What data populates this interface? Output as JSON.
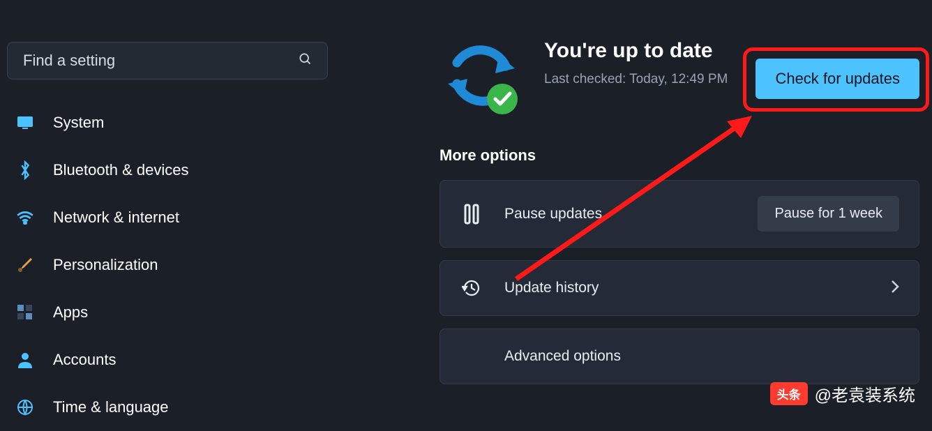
{
  "search": {
    "placeholder": "Find a setting"
  },
  "sidebar": {
    "items": [
      {
        "label": "System",
        "icon": "system-icon",
        "color": "#4cc2ff"
      },
      {
        "label": "Bluetooth & devices",
        "icon": "bluetooth-icon",
        "color": "#4cc2ff"
      },
      {
        "label": "Network & internet",
        "icon": "wifi-icon",
        "color": "#4cc2ff"
      },
      {
        "label": "Personalization",
        "icon": "brush-icon",
        "color": "#e8a04a"
      },
      {
        "label": "Apps",
        "icon": "apps-icon",
        "color": "#6f7a8c"
      },
      {
        "label": "Accounts",
        "icon": "person-icon",
        "color": "#4cc2ff"
      },
      {
        "label": "Time & language",
        "icon": "globe-icon",
        "color": "#4cc2ff"
      }
    ]
  },
  "status": {
    "title": "You're up to date",
    "last_checked": "Last checked: Today, 12:49 PM",
    "button": "Check for updates"
  },
  "more_options_label": "More options",
  "cards": {
    "pause": {
      "label": "Pause updates",
      "action": "Pause for 1 week"
    },
    "history": {
      "label": "Update history"
    },
    "advanced": {
      "label": "Advanced options"
    }
  },
  "watermark": {
    "badge": "头条",
    "text": "@老袁装系统"
  },
  "colors": {
    "accent": "#4cc2ff",
    "highlight": "#ff1a1a",
    "success": "#39b54a"
  }
}
